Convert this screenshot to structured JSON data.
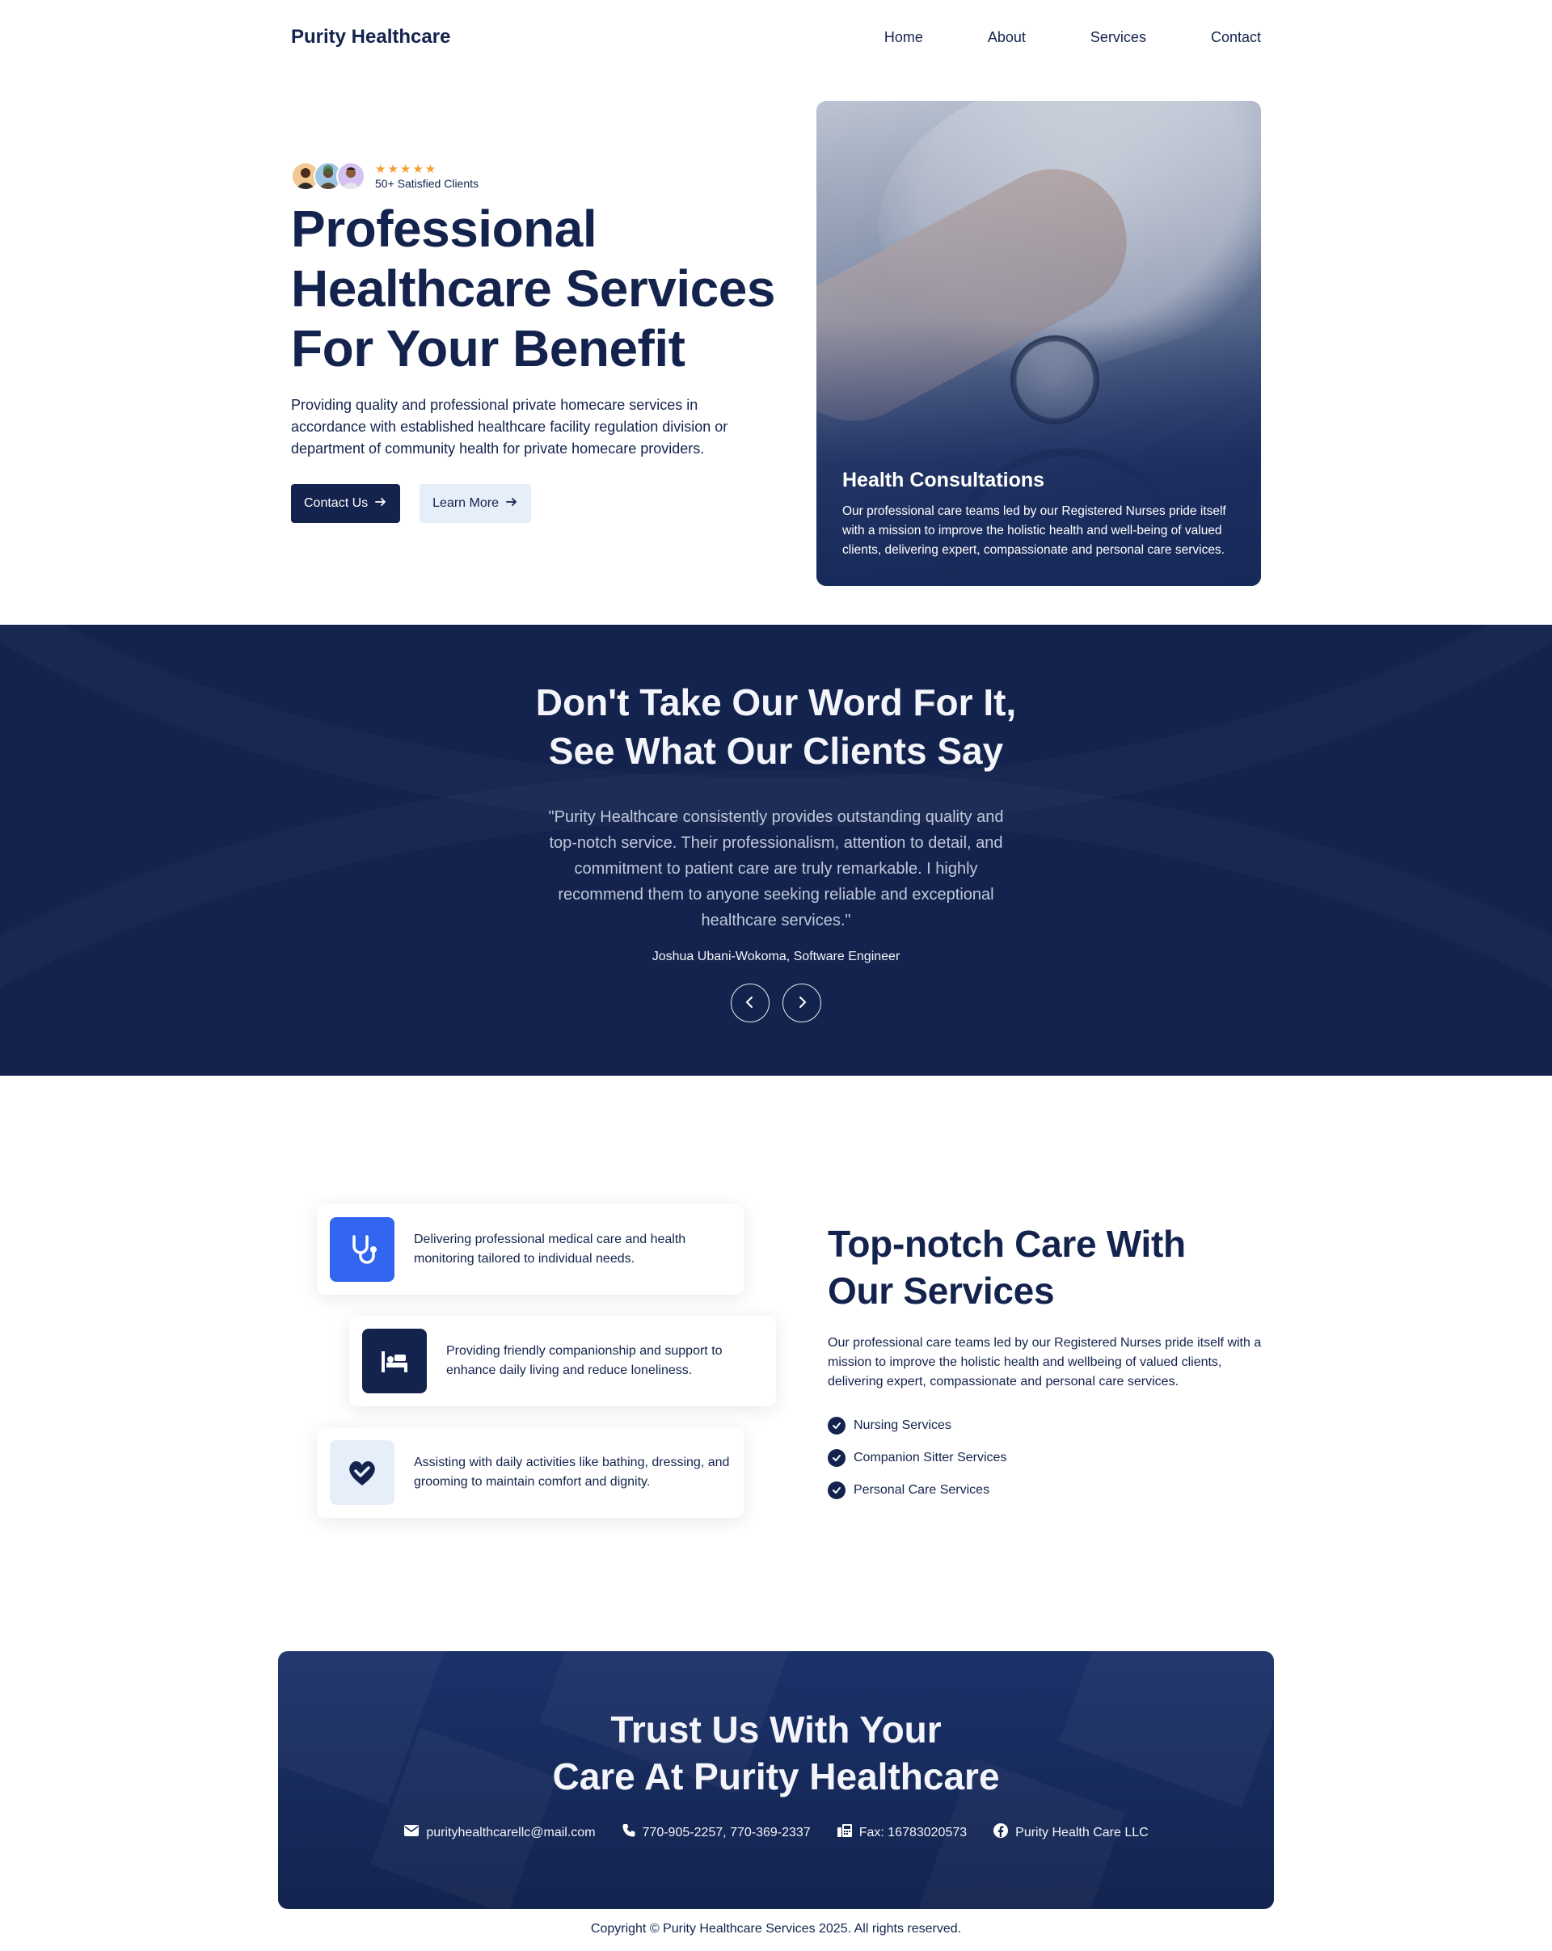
{
  "nav": {
    "brand": "Purity Healthcare",
    "links": [
      "Home",
      "About",
      "Services",
      "Contact"
    ]
  },
  "hero": {
    "stars": "★★★★★",
    "clients_text": "50+ Satisfied Clients",
    "title_lines": [
      "Professional",
      "Healthcare Services",
      "For Your Benefit"
    ],
    "description": "Providing quality and professional private homecare services in accordance with established healthcare facility regulation division or department of community health for private homecare providers.",
    "primary_button": "Contact Us",
    "secondary_button": "Learn More",
    "card": {
      "title": "Health Consultations",
      "body": "Our professional care teams led by our Registered Nurses pride itself with a mission to improve the holistic health and well-being of valued clients, delivering expert, compassionate and personal care services."
    }
  },
  "testimonial": {
    "title_lines": [
      "Don't Take Our Word For It,",
      "See What Our Clients Say"
    ],
    "quote": "\"Purity Healthcare consistently provides outstanding quality and top-notch service. Their professionalism, attention to detail, and commitment to patient care are truly remarkable. I highly recommend them to anyone seeking reliable and exceptional healthcare services.\"",
    "author": "Joshua Ubani-Wokoma, Software Engineer"
  },
  "services": {
    "cards": [
      {
        "icon": "stethoscope-icon",
        "text": "Delivering professional medical care and health monitoring tailored to individual needs."
      },
      {
        "icon": "bed-icon",
        "text": "Providing friendly companionship and support to enhance daily living and reduce loneliness."
      },
      {
        "icon": "heart-check-icon",
        "text": "Assisting with daily activities like bathing, dressing, and grooming to maintain comfort and dignity."
      }
    ],
    "title_lines": [
      "Top-notch Care With",
      "Our Services"
    ],
    "description": "Our professional care teams led by our Registered Nurses pride itself with a mission to improve the holistic health and wellbeing of valued clients, delivering expert, compassionate and personal care services.",
    "list": [
      "Nursing Services",
      "Companion Sitter Services",
      "Personal Care Services"
    ]
  },
  "cta": {
    "title_lines": [
      "Trust Us With Your",
      "Care At Purity Healthcare"
    ],
    "email": "purityhealthcarellc@mail.com",
    "phone": "770-905-2257, 770-369-2337",
    "fax": "Fax: 16783020573",
    "facebook": "Purity Health Care LLC"
  },
  "footer": {
    "copyright": "Copyright © Purity Healthcare Services 2025. All rights reserved."
  },
  "colors": {
    "navy": "#13234d",
    "accent_blue": "#3366f0",
    "star": "#f59e32",
    "light_button": "#e6eefa"
  }
}
